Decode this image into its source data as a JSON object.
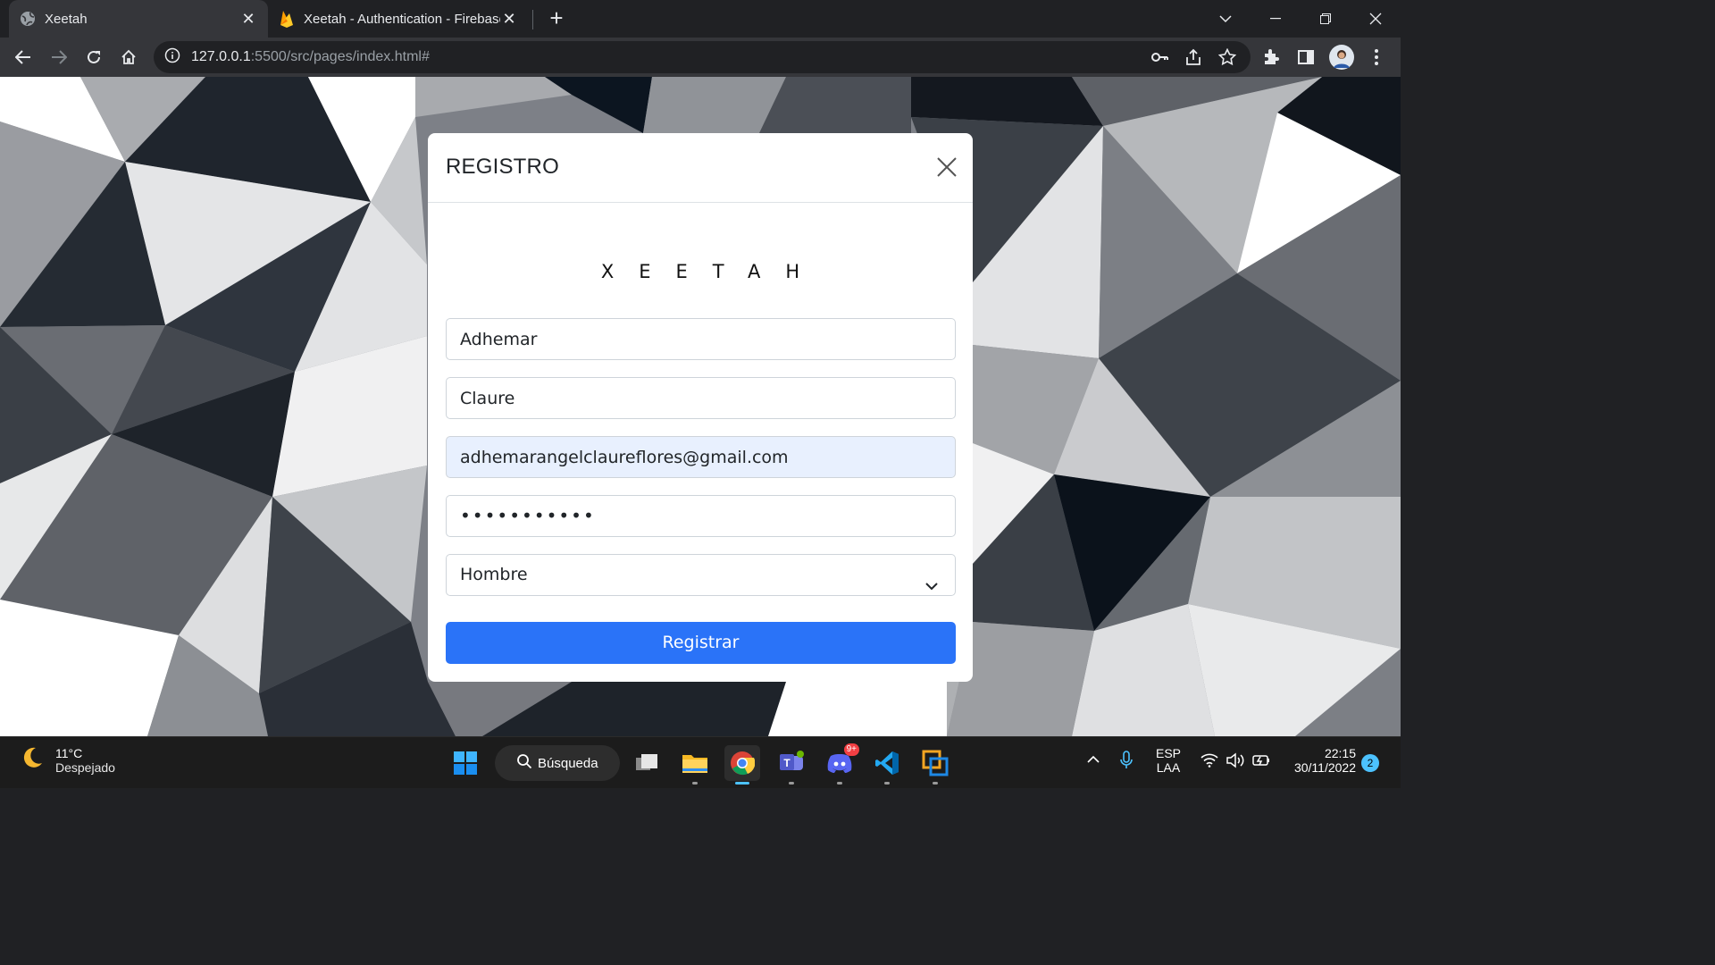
{
  "browser": {
    "tabs": [
      {
        "title": "Xeetah",
        "active": true,
        "icon": "globe-icon"
      },
      {
        "title": "Xeetah - Authentication - Firebase",
        "active": false,
        "icon": "firebase-icon"
      }
    ],
    "url_host": "127.0.0.1",
    "url_rest": ":5500/src/pages/index.html#"
  },
  "modal": {
    "title": "REGISTRO",
    "brand": "XEETAH",
    "fields": {
      "first_name": "Adhemar",
      "last_name": "Claure",
      "email": "adhemarangelclaureflores@gmail.com",
      "password_masked": "•••••••••••",
      "gender": "Hombre"
    },
    "submit_label": "Registrar"
  },
  "taskbar": {
    "temperature": "11°C",
    "weather": "Despejado",
    "search_label": "Búsqueda",
    "language_top": "ESP",
    "language_bottom": "LAA",
    "time": "22:15",
    "date": "30/11/2022",
    "notifications": "2",
    "discord_badge": "9+"
  },
  "colors": {
    "accent": "#2a73f8",
    "autofill": "#e8f0fe",
    "chrome_dark": "#202124",
    "chrome_toolbar": "#35363a"
  }
}
